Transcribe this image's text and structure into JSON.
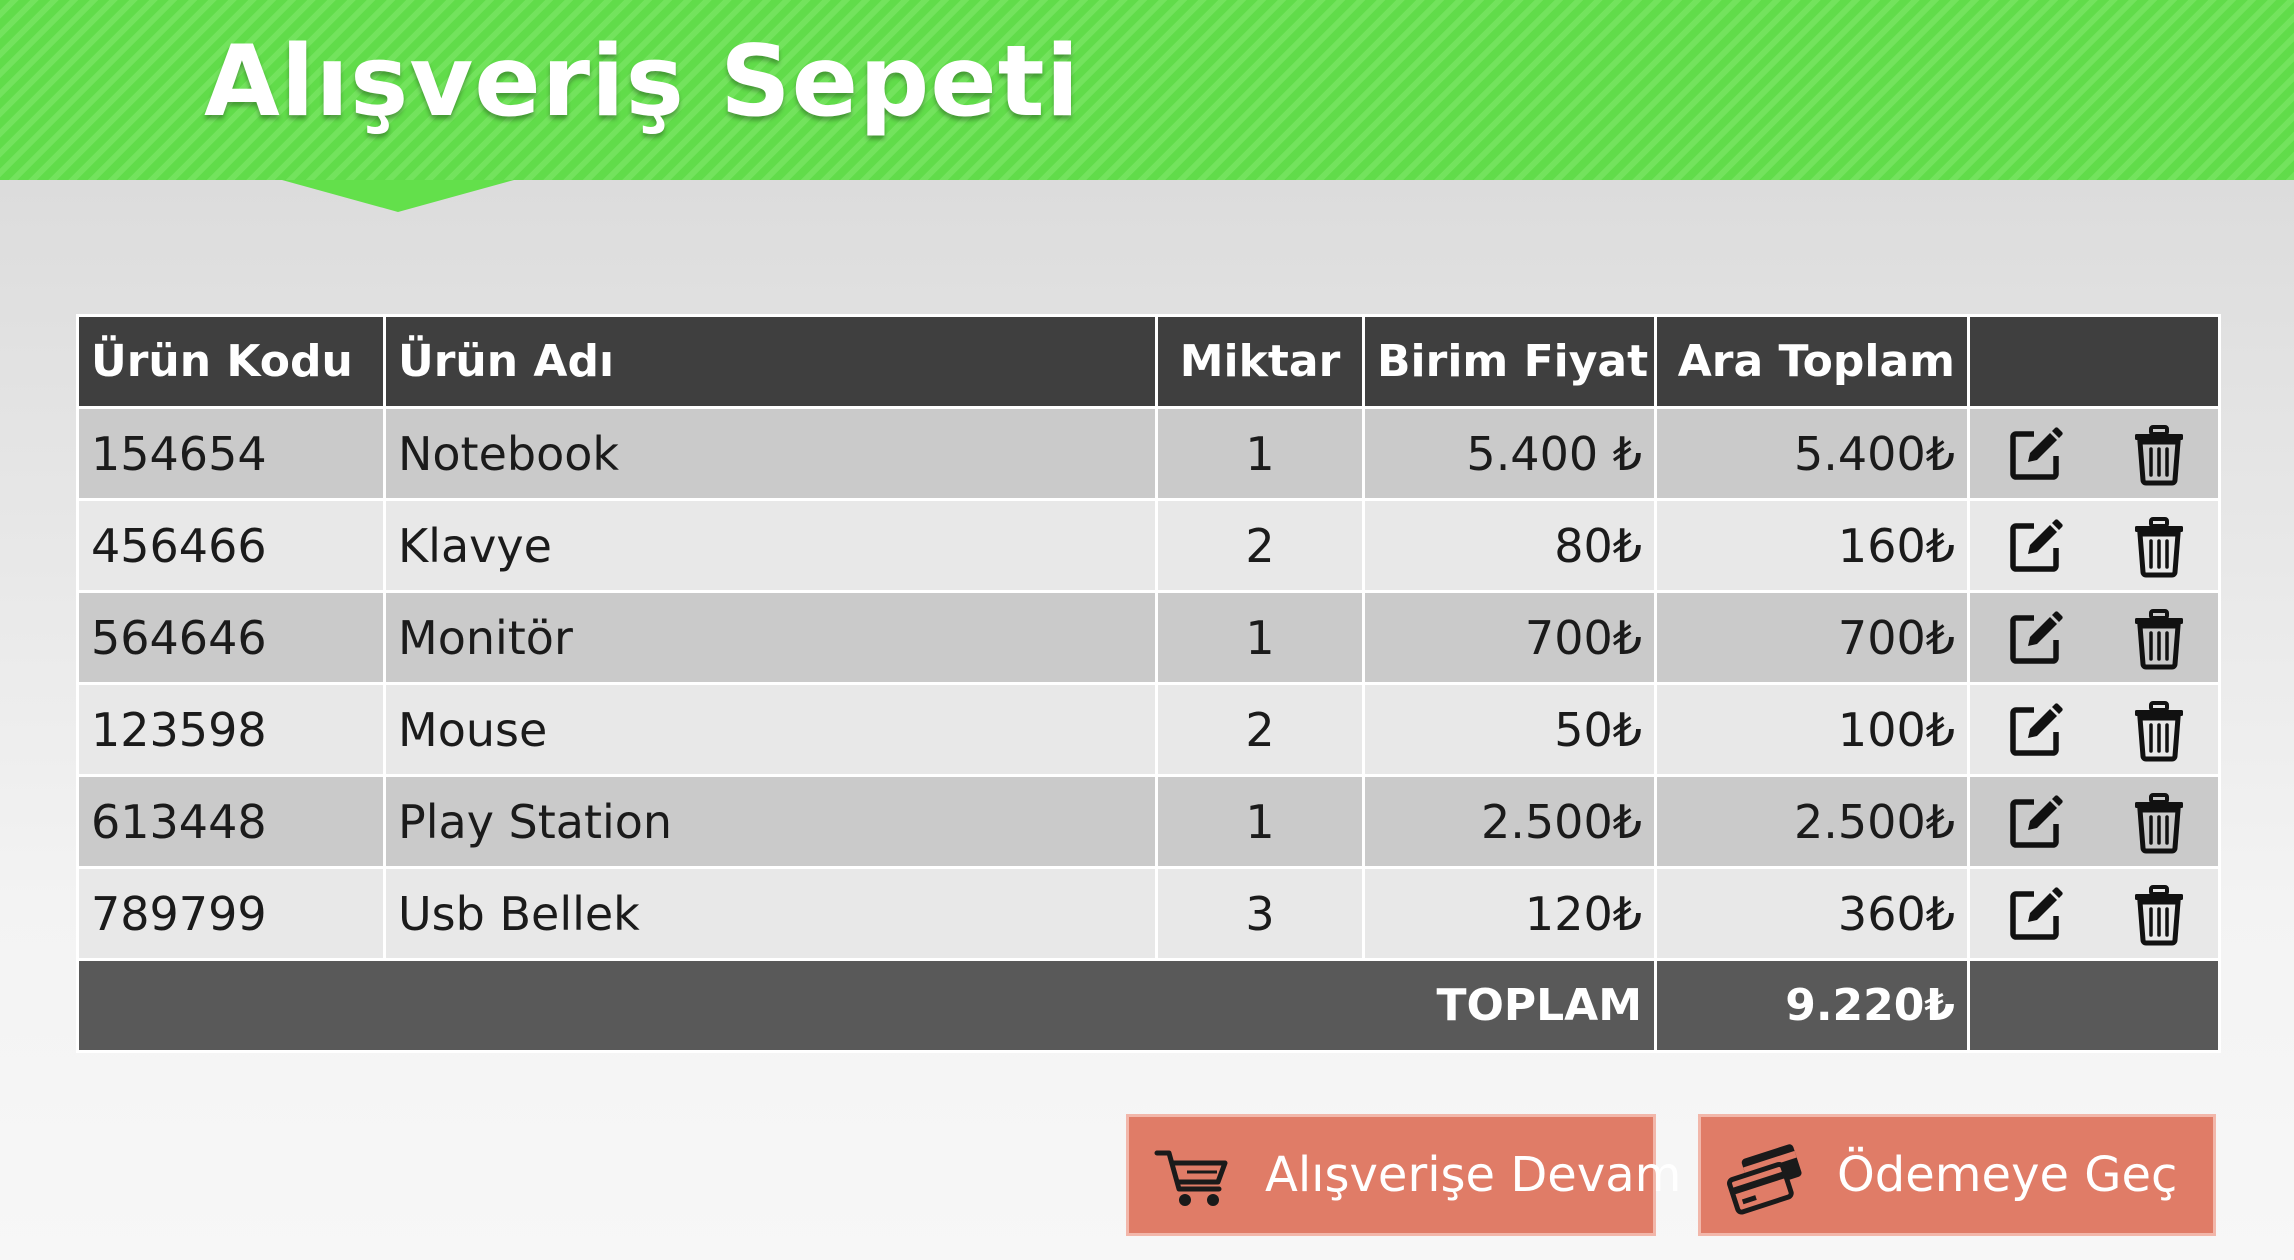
{
  "header": {
    "title": "Alışveriş Sepeti",
    "color": "#63e04b"
  },
  "table": {
    "columns": [
      "Ürün Kodu",
      "Ürün Adı",
      "Miktar",
      "Birim Fiyat",
      "Ara Toplam"
    ],
    "rows": [
      {
        "code": "154654",
        "name": "Notebook",
        "qty": "1",
        "unit_price": "5.400 ₺",
        "subtotal": "5.400₺"
      },
      {
        "code": "456466",
        "name": "Klavye",
        "qty": "2",
        "unit_price": "80₺",
        "subtotal": "160₺"
      },
      {
        "code": "564646",
        "name": "Monitör",
        "qty": "1",
        "unit_price": "700₺",
        "subtotal": "700₺"
      },
      {
        "code": "123598",
        "name": "Mouse",
        "qty": "2",
        "unit_price": "50₺",
        "subtotal": "100₺"
      },
      {
        "code": "613448",
        "name": "Play Station",
        "qty": "1",
        "unit_price": "2.500₺",
        "subtotal": "2.500₺"
      },
      {
        "code": "789799",
        "name": "Usb Bellek",
        "qty": "3",
        "unit_price": "120₺",
        "subtotal": "360₺"
      }
    ],
    "row_actions": [
      "edit-icon",
      "trash-icon"
    ],
    "total_label": "TOPLAM",
    "total_value": "9.220₺"
  },
  "buttons": {
    "continue": {
      "label": "Alışverişe Devam",
      "icon": "cart-icon"
    },
    "checkout": {
      "label": "Ödemeye Geç",
      "icon": "credit-cards-icon"
    },
    "color": "#e07c67"
  }
}
